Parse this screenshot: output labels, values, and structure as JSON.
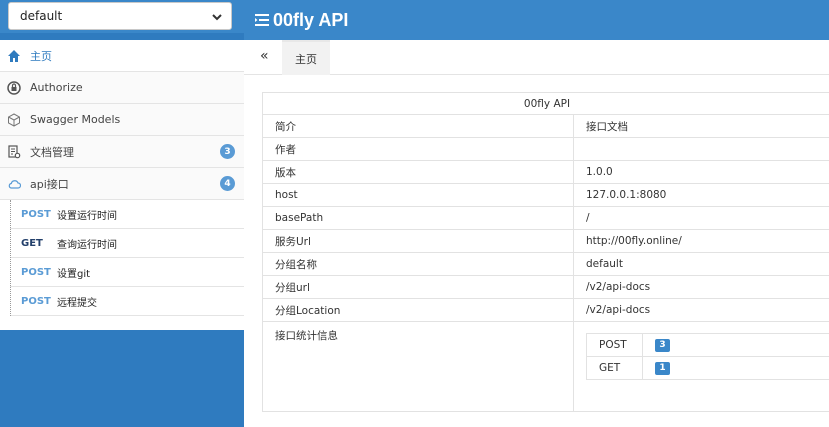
{
  "group_select": {
    "value": "default"
  },
  "header": {
    "title": "00fly API"
  },
  "sidebar": {
    "items": [
      {
        "label": "主页"
      },
      {
        "label": "Authorize"
      },
      {
        "label": "Swagger Models"
      },
      {
        "label": "文档管理",
        "badge": "3"
      },
      {
        "label": "api接口",
        "badge": "4"
      }
    ],
    "api_list": [
      {
        "method": "POST",
        "label": "设置运行时间"
      },
      {
        "method": "GET",
        "label": "查询运行时间"
      },
      {
        "method": "POST",
        "label": "设置git"
      },
      {
        "method": "POST",
        "label": "远程提交"
      }
    ]
  },
  "tabs": {
    "collapse": "«",
    "home": "主页"
  },
  "info": {
    "caption": "00fly API",
    "rows": [
      {
        "k": "简介",
        "v": "接口文档"
      },
      {
        "k": "作者",
        "v": ""
      },
      {
        "k": "版本",
        "v": "1.0.0"
      },
      {
        "k": "host",
        "v": "127.0.0.1:8080"
      },
      {
        "k": "basePath",
        "v": "/"
      },
      {
        "k": "服务Url",
        "v": "http://00fly.online/"
      },
      {
        "k": "分组名称",
        "v": "default"
      },
      {
        "k": "分组url",
        "v": "/v2/api-docs"
      },
      {
        "k": "分组Location",
        "v": "/v2/api-docs"
      }
    ],
    "stats_label": "接口统计信息",
    "stats": [
      {
        "method": "POST",
        "count": "3"
      },
      {
        "method": "GET",
        "count": "1"
      }
    ]
  },
  "colors": {
    "primary": "#3a87c9",
    "sidebar_bg": "#2f7bbf",
    "badge": "#5a9bd5"
  }
}
